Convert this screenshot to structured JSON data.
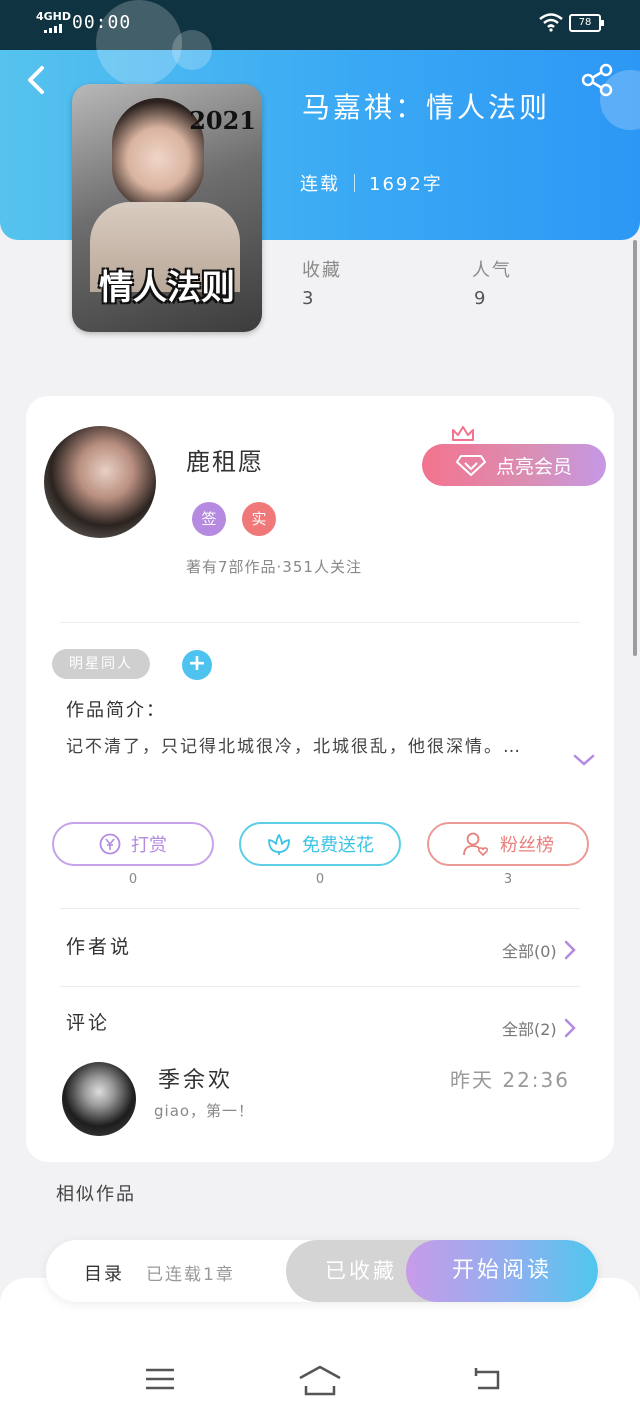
{
  "status_bar": {
    "network": "4GHD",
    "time": "00:00",
    "battery": "78"
  },
  "book": {
    "title": "马嘉祺：情人法则",
    "status": "连载",
    "word_count": "1692字",
    "cover_year": "2021",
    "cover_title": "情人法则",
    "favorites_label": "收藏",
    "favorites_value": "3",
    "popularity_label": "人气",
    "popularity_value": "9"
  },
  "author": {
    "name": "鹿租愿",
    "badge_signed": "签",
    "badge_verified": "实",
    "stats": "著有7部作品·351人关注",
    "vip_label": "点亮会员"
  },
  "tags": {
    "category": "明星同人",
    "add": "+"
  },
  "intro": {
    "label": "作品简介：",
    "text": "记不清了，只记得北城很冷，北城很乱，他很深情。…"
  },
  "actions": {
    "tip_label": "打赏",
    "tip_count": "0",
    "flower_label": "免费送花",
    "flower_count": "0",
    "fans_label": "粉丝榜",
    "fans_count": "3"
  },
  "author_notes": {
    "title": "作者说",
    "all": "全部(0)"
  },
  "comments": {
    "title": "评论",
    "all": "全部(2)",
    "items": [
      {
        "user": "季余欢",
        "time": "昨天 22:36",
        "text": "giao，第一！"
      }
    ]
  },
  "similar": {
    "title": "相似作品"
  },
  "read_bar": {
    "toc": "目录",
    "chapters": "已连载1章",
    "favorited": "已收藏",
    "start_reading": "开始阅读"
  },
  "colors": {
    "header_blue": "#3aa9f4",
    "tip_purple": "#b58ae0",
    "flower_cyan": "#3cc4e6",
    "fans_red": "#e7807c",
    "vip_pink": "#f3738e"
  }
}
